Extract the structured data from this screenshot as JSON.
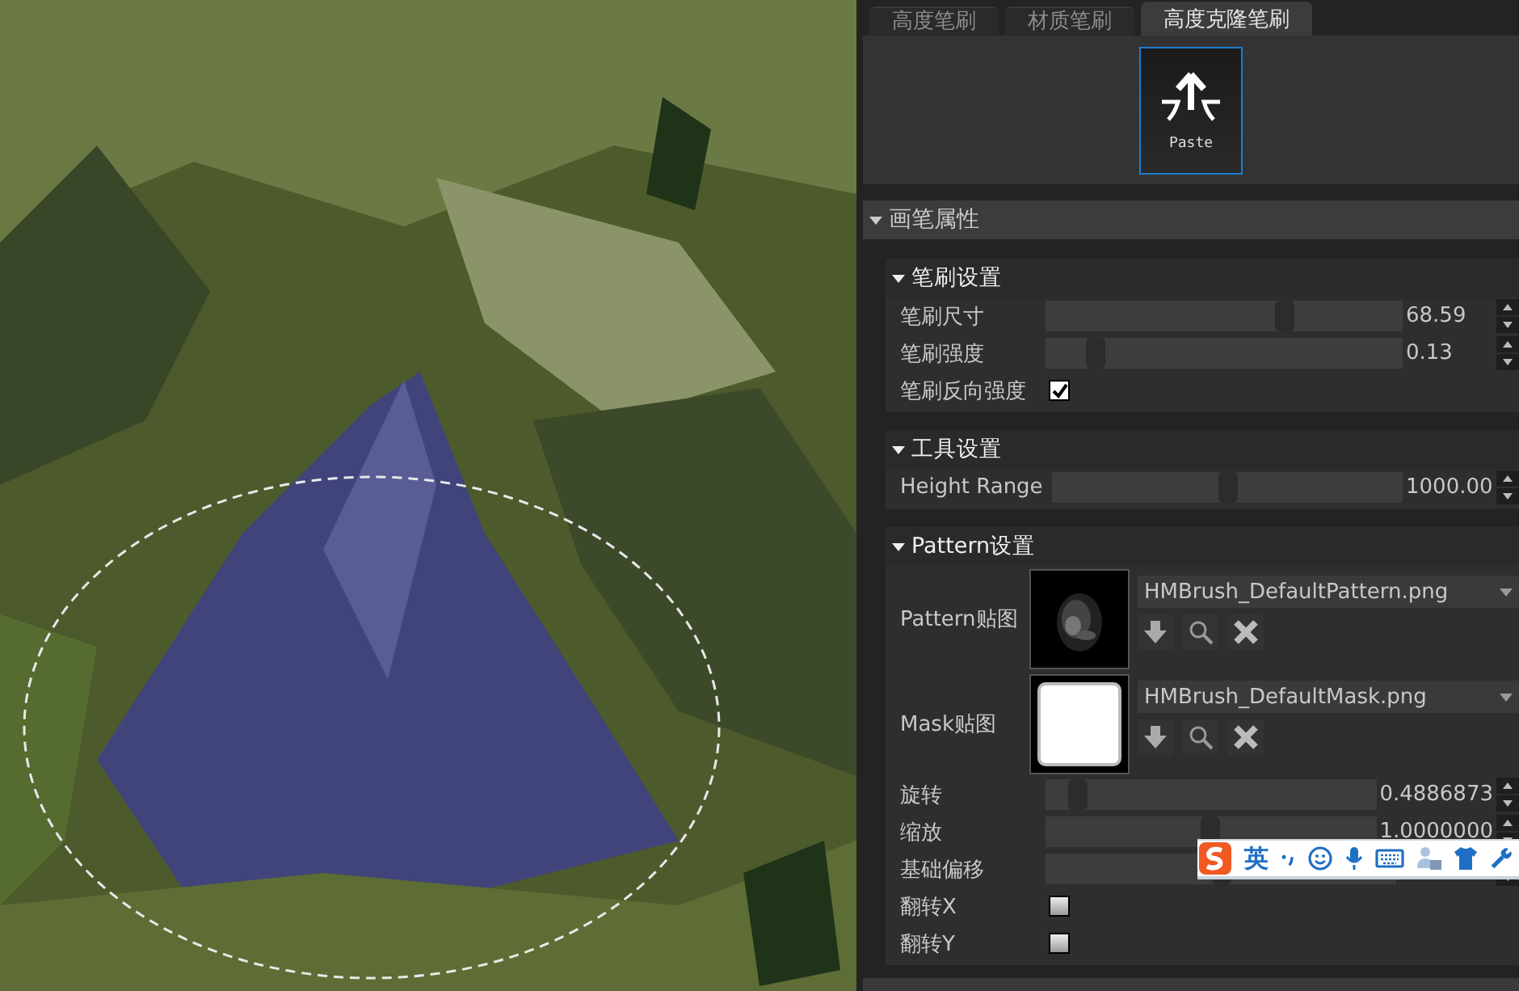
{
  "tabs": [
    {
      "label": "高度笔刷",
      "selected": false
    },
    {
      "label": "材质笔刷",
      "selected": false
    },
    {
      "label": "高度克隆笔刷",
      "selected": true
    }
  ],
  "tools": [
    {
      "label": "Paste",
      "selected": true
    }
  ],
  "section": {
    "title": "画笔属性",
    "expanded": true
  },
  "groups": [
    {
      "title": "笔刷设置",
      "expanded": true,
      "rows": [
        {
          "kind": "slider",
          "label": "笔刷尺寸",
          "level": 0.67,
          "value": "68.59"
        },
        {
          "kind": "slider",
          "label": "笔刷强度",
          "level": 0.14,
          "value": "0.13"
        },
        {
          "kind": "checkbox",
          "label": "笔刷反向强度",
          "checked": true
        }
      ]
    },
    {
      "title": "工具设置",
      "expanded": true,
      "rows": [
        {
          "kind": "slider",
          "label": "Height Range",
          "level": 0.5,
          "value": "1000.00"
        }
      ]
    },
    {
      "title": "Pattern设置",
      "expanded": true,
      "rows": [
        {
          "kind": "pattern",
          "label": "Pattern贴图",
          "file": "HMBrush_DefaultPattern.png"
        },
        {
          "kind": "mask",
          "label": "Mask贴图",
          "file": "HMBrush_DefaultMask.png"
        },
        {
          "kind": "slider",
          "label": "旋转",
          "level": 0.1,
          "value": "0.4886873"
        },
        {
          "kind": "slider",
          "label": "缩放",
          "level": 0.5,
          "value": "1.0000000"
        },
        {
          "kind": "slider",
          "label": "基础偏移",
          "level": 0.5
        },
        {
          "kind": "checkbox",
          "label": "翻转X",
          "checked": false
        },
        {
          "kind": "checkbox",
          "label": "翻转Y",
          "checked": false
        }
      ]
    }
  ],
  "ime_bar": {
    "mode": "英"
  }
}
